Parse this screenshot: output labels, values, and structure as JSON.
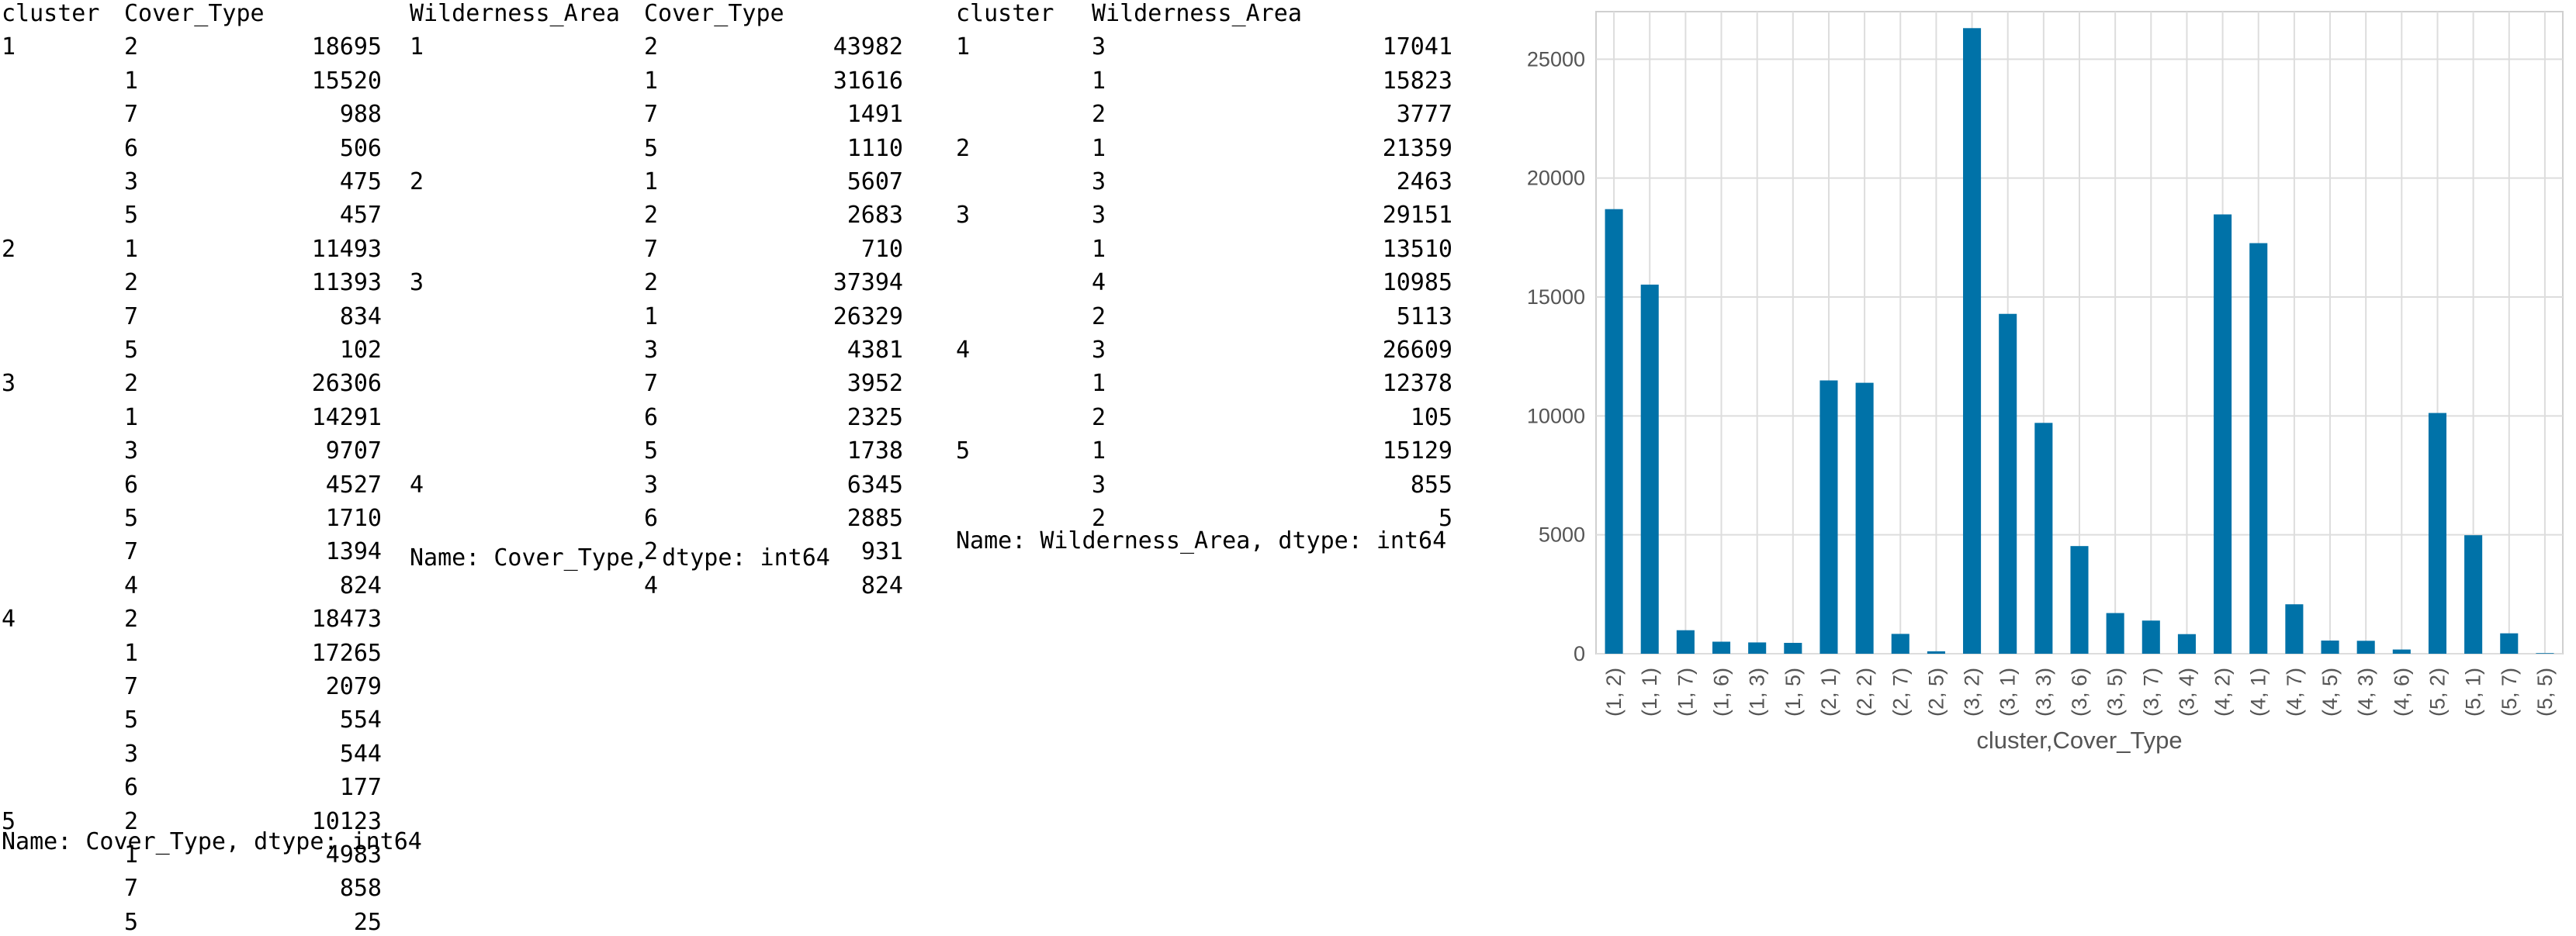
{
  "table1": {
    "headers": [
      "cluster",
      "Cover_Type"
    ],
    "rows": [
      [
        "1",
        "2",
        "18695"
      ],
      [
        "",
        "1",
        "15520"
      ],
      [
        "",
        "7",
        "988"
      ],
      [
        "",
        "6",
        "506"
      ],
      [
        "",
        "3",
        "475"
      ],
      [
        "",
        "5",
        "457"
      ],
      [
        "2",
        "1",
        "11493"
      ],
      [
        "",
        "2",
        "11393"
      ],
      [
        "",
        "7",
        "834"
      ],
      [
        "",
        "5",
        "102"
      ],
      [
        "3",
        "2",
        "26306"
      ],
      [
        "",
        "1",
        "14291"
      ],
      [
        "",
        "3",
        "9707"
      ],
      [
        "",
        "6",
        "4527"
      ],
      [
        "",
        "5",
        "1710"
      ],
      [
        "",
        "7",
        "1394"
      ],
      [
        "",
        "4",
        "824"
      ],
      [
        "4",
        "2",
        "18473"
      ],
      [
        "",
        "1",
        "17265"
      ],
      [
        "",
        "7",
        "2079"
      ],
      [
        "",
        "5",
        "554"
      ],
      [
        "",
        "3",
        "544"
      ],
      [
        "",
        "6",
        "177"
      ],
      [
        "5",
        "2",
        "10123"
      ],
      [
        "",
        "1",
        "4983"
      ],
      [
        "",
        "7",
        "858"
      ],
      [
        "",
        "5",
        "25"
      ]
    ],
    "footer": "Name: Cover_Type, dtype: int64"
  },
  "table2": {
    "headers": [
      "Wilderness_Area",
      "Cover_Type"
    ],
    "rows": [
      [
        "1",
        "2",
        "43982"
      ],
      [
        "",
        "1",
        "31616"
      ],
      [
        "",
        "7",
        "1491"
      ],
      [
        "",
        "5",
        "1110"
      ],
      [
        "2",
        "1",
        "5607"
      ],
      [
        "",
        "2",
        "2683"
      ],
      [
        "",
        "7",
        "710"
      ],
      [
        "3",
        "2",
        "37394"
      ],
      [
        "",
        "1",
        "26329"
      ],
      [
        "",
        "3",
        "4381"
      ],
      [
        "",
        "7",
        "3952"
      ],
      [
        "",
        "6",
        "2325"
      ],
      [
        "",
        "5",
        "1738"
      ],
      [
        "4",
        "3",
        "6345"
      ],
      [
        "",
        "6",
        "2885"
      ],
      [
        "",
        "2",
        "931"
      ],
      [
        "",
        "4",
        "824"
      ]
    ],
    "footer": "Name: Cover_Type, dtype: int64"
  },
  "table3": {
    "headers": [
      "cluster",
      "Wilderness_Area"
    ],
    "rows": [
      [
        "1",
        "3",
        "17041"
      ],
      [
        "",
        "1",
        "15823"
      ],
      [
        "",
        "2",
        "3777"
      ],
      [
        "2",
        "1",
        "21359"
      ],
      [
        "",
        "3",
        "2463"
      ],
      [
        "3",
        "3",
        "29151"
      ],
      [
        "",
        "1",
        "13510"
      ],
      [
        "",
        "4",
        "10985"
      ],
      [
        "",
        "2",
        "5113"
      ],
      [
        "4",
        "3",
        "26609"
      ],
      [
        "",
        "1",
        "12378"
      ],
      [
        "",
        "2",
        "105"
      ],
      [
        "5",
        "1",
        "15129"
      ],
      [
        "",
        "3",
        "855"
      ],
      [
        "",
        "2",
        "5"
      ]
    ],
    "footer": "Name: Wilderness_Area, dtype: int64"
  },
  "chart_data": {
    "type": "bar",
    "categories": [
      "(1, 2)",
      "(1, 1)",
      "(1, 7)",
      "(1, 6)",
      "(1, 3)",
      "(1, 5)",
      "(2, 1)",
      "(2, 2)",
      "(2, 7)",
      "(2, 5)",
      "(3, 2)",
      "(3, 1)",
      "(3, 3)",
      "(3, 6)",
      "(3, 5)",
      "(3, 7)",
      "(3, 4)",
      "(4, 2)",
      "(4, 1)",
      "(4, 7)",
      "(4, 5)",
      "(4, 3)",
      "(4, 6)",
      "(5, 2)",
      "(5, 1)",
      "(5, 7)",
      "(5, 5)"
    ],
    "values": [
      18695,
      15520,
      988,
      506,
      475,
      457,
      11493,
      11393,
      834,
      102,
      26306,
      14291,
      9707,
      4527,
      1710,
      1394,
      824,
      18473,
      17265,
      2079,
      554,
      544,
      177,
      10123,
      4983,
      858,
      25
    ],
    "xlabel": "cluster,Cover_Type",
    "ylabel": "",
    "ylim": [
      0,
      27000
    ],
    "yticks": [
      0,
      5000,
      10000,
      15000,
      20000,
      25000
    ],
    "grid": true,
    "bar_color": "#0072a8"
  }
}
